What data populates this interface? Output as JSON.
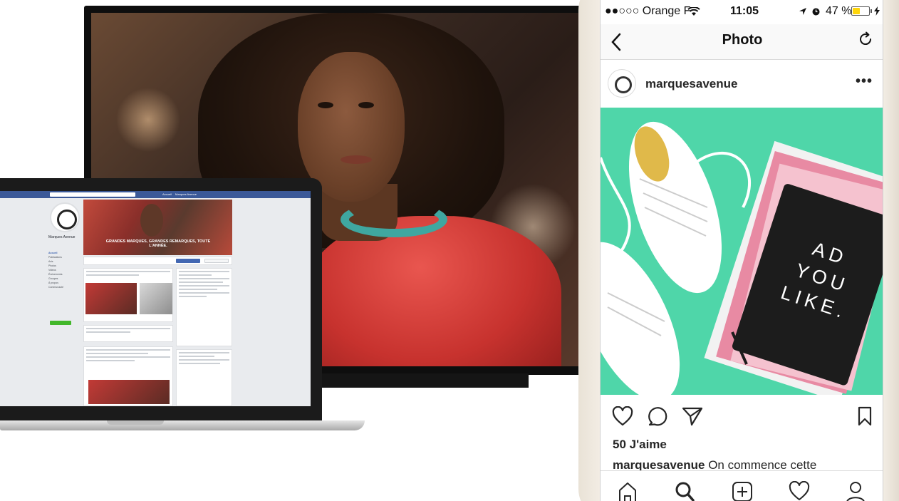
{
  "laptop_facebook": {
    "bar_link_1": "Accueil",
    "bar_link_2": "Marques Avenue",
    "page_name": "Marques Avenue",
    "cover_text": "GRANDES MARQUES, GRANDES REMARQUES, TOUTE L'ANNÉE.",
    "menu_items": [
      "Accueil",
      "Publications",
      "Avis",
      "Photos",
      "Vidéos",
      "Événements",
      "Groupes",
      "À propos",
      "Communauté"
    ]
  },
  "phone": {
    "status": {
      "carrier": "●●○○○ Orange F",
      "time": "11:05",
      "battery_text": "47 %",
      "battery_level": 0.47
    },
    "nav": {
      "title": "Photo"
    },
    "post": {
      "username": "marquesavenue",
      "likes": "50 J'aime",
      "caption_user": "marquesavenue",
      "caption_text": "On commence cette",
      "notebook_text": "AD YOU LIKE."
    }
  },
  "colors": {
    "facebook_blue": "#3b5998",
    "post_background": "#4fd6a9",
    "battery_yellow": "#ffd60a",
    "dress_red": "#d0393a"
  }
}
